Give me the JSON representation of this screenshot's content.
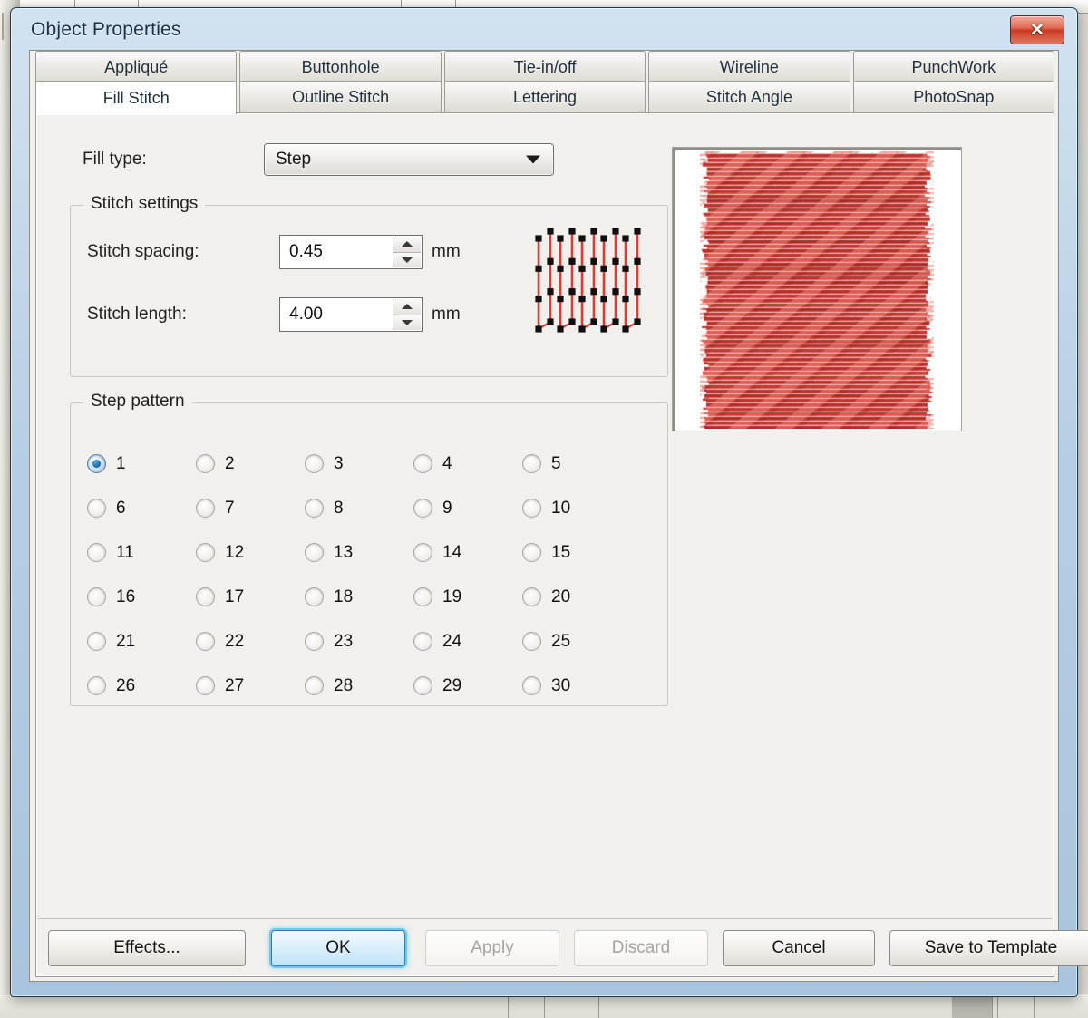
{
  "window": {
    "title": "Object Properties",
    "close_label": "✕",
    "titlebar_color": "#b6cee5",
    "close_button_color": "#cc3a22"
  },
  "tabs": {
    "row1": [
      {
        "label": "Appliqué",
        "active": false
      },
      {
        "label": "Buttonhole",
        "active": false
      },
      {
        "label": "Tie-in/off",
        "active": false
      },
      {
        "label": "Wireline",
        "active": false
      },
      {
        "label": "PunchWork",
        "active": false
      }
    ],
    "row2": [
      {
        "label": "Fill Stitch",
        "active": true
      },
      {
        "label": "Outline Stitch",
        "active": false
      },
      {
        "label": "Lettering",
        "active": false
      },
      {
        "label": "Stitch Angle",
        "active": false
      },
      {
        "label": "PhotoSnap",
        "active": false
      }
    ]
  },
  "fill_type": {
    "label": "Fill type:",
    "value": "Step",
    "options": [
      "Step"
    ]
  },
  "stitch_settings": {
    "legend": "Stitch settings",
    "spacing": {
      "label": "Stitch spacing:",
      "value": "0.45",
      "unit": "mm"
    },
    "length": {
      "label": "Stitch length:",
      "value": "4.00",
      "unit": "mm"
    }
  },
  "step_pattern": {
    "legend": "Step pattern",
    "selected": 1,
    "options": [
      "1",
      "2",
      "3",
      "4",
      "5",
      "6",
      "7",
      "8",
      "9",
      "10",
      "11",
      "12",
      "13",
      "14",
      "15",
      "16",
      "17",
      "18",
      "19",
      "20",
      "21",
      "22",
      "23",
      "24",
      "25",
      "26",
      "27",
      "28",
      "29",
      "30"
    ]
  },
  "preview": {
    "thread_color": "#d94a42",
    "thread_highlight": "#ef7a6e",
    "thread_shadow": "#a8201c"
  },
  "diagram": {
    "line_color": "#e8372f",
    "node_color": "#111111"
  },
  "buttons": {
    "effects": {
      "label": "Effects...",
      "disabled": false,
      "default": false
    },
    "ok": {
      "label": "OK",
      "disabled": false,
      "default": true
    },
    "apply": {
      "label": "Apply",
      "disabled": true,
      "default": false
    },
    "discard": {
      "label": "Discard",
      "disabled": true,
      "default": false
    },
    "cancel": {
      "label": "Cancel",
      "disabled": false,
      "default": false
    },
    "save": {
      "label": "Save to Template",
      "disabled": false,
      "default": false
    }
  }
}
